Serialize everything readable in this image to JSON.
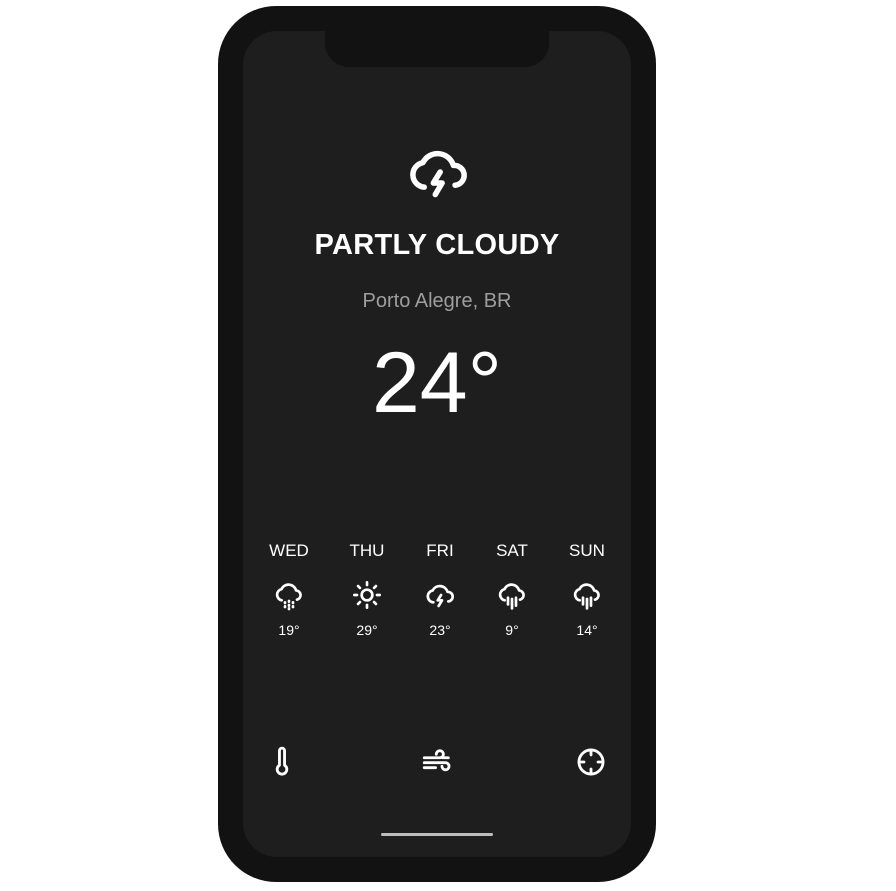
{
  "current": {
    "condition": "PARTLY CLOUDY",
    "location": "Porto Alegre, BR",
    "temperature": "24°",
    "icon": "thunderstorm-icon"
  },
  "forecast": [
    {
      "day": "WED",
      "temp": "19°",
      "icon": "drizzle-icon"
    },
    {
      "day": "THU",
      "temp": "29°",
      "icon": "sun-icon"
    },
    {
      "day": "FRI",
      "temp": "23°",
      "icon": "thunderstorm-icon"
    },
    {
      "day": "SAT",
      "temp": "9°",
      "icon": "rain-icon"
    },
    {
      "day": "SUN",
      "temp": "14°",
      "icon": "rain-icon"
    }
  ],
  "bottom_nav": [
    {
      "icon": "thermometer-icon"
    },
    {
      "icon": "wind-icon"
    },
    {
      "icon": "location-crosshair-icon"
    }
  ],
  "colors": {
    "phone_frame": "#121212",
    "screen_background": "#1e1e1e",
    "primary_text": "#ffffff",
    "secondary_text": "#9e9e9e"
  }
}
